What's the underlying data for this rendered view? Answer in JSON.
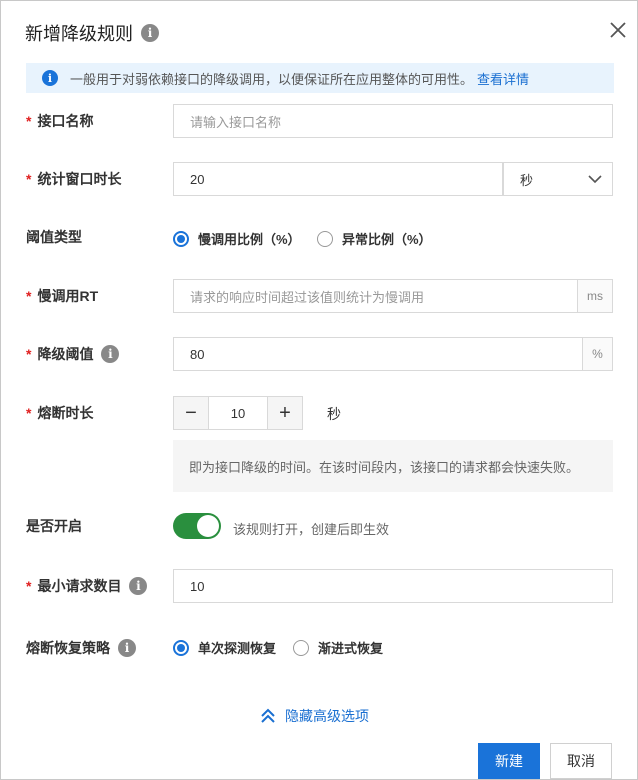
{
  "dialog": {
    "title": "新增降级规则",
    "info_icon": "i",
    "close_icon": "close-icon"
  },
  "notice": {
    "icon": "i",
    "text": "一般用于对弱依赖接口的降级调用，以便保证所在应用整体的可用性。",
    "link": "查看详情"
  },
  "fields": {
    "api_name": {
      "required": "*",
      "label": "接口名称",
      "placeholder": "请输入接口名称"
    },
    "window": {
      "required": "*",
      "label": "统计窗口时长",
      "value": "20",
      "unit": "秒"
    },
    "threshold_type": {
      "label": "阈值类型",
      "options": [
        "慢调用比例（%）",
        "异常比例（%）"
      ],
      "selected": 0
    },
    "slow_rt": {
      "required": "*",
      "label": "慢调用RT",
      "placeholder": "请求的响应时间超过该值则统计为慢调用",
      "suffix": "ms"
    },
    "threshold": {
      "required": "*",
      "label": "降级阈值",
      "value": "80",
      "suffix": "%"
    },
    "break_duration": {
      "required": "*",
      "label": "熔断时长",
      "minus": "−",
      "value": "10",
      "plus": "+",
      "unit": "秒",
      "help": "即为接口降级的时间。在该时间段内，该接口的请求都会快速失败。"
    },
    "enabled": {
      "label": "是否开启",
      "on": true,
      "hint": "该规则打开，创建后即生效"
    },
    "min_requests": {
      "required": "*",
      "label": "最小请求数目",
      "value": "10"
    },
    "recovery": {
      "label": "熔断恢复策略",
      "options": [
        "单次探测恢复",
        "渐进式恢复"
      ],
      "selected": 0
    }
  },
  "advanced_toggle": "隐藏高级选项",
  "actions": {
    "create": "新建",
    "cancel": "取消"
  }
}
